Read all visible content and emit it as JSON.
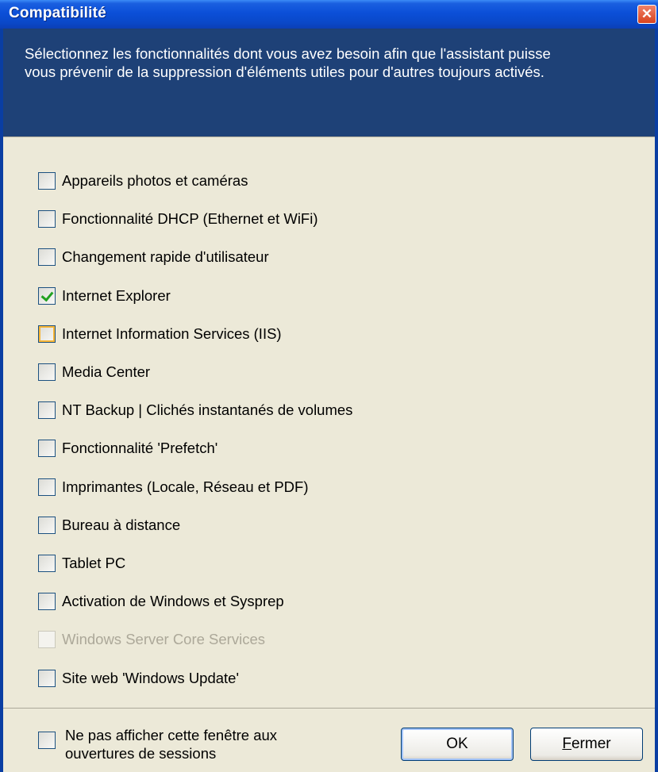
{
  "window": {
    "title": "Compatibilité",
    "close_glyph": "✕"
  },
  "header": {
    "description_line1": "Sélectionnez les fonctionnalités dont vous avez besoin afin que l'assistant puisse",
    "description_line2": "vous prévenir de la suppression d'éléments utiles pour d'autres toujours activés."
  },
  "options": [
    {
      "label": "Appareils photos et caméras",
      "checked": false,
      "state": "normal"
    },
    {
      "label": "Fonctionnalité DHCP (Ethernet et WiFi)",
      "checked": false,
      "state": "normal"
    },
    {
      "label": "Changement rapide d'utilisateur",
      "checked": false,
      "state": "normal"
    },
    {
      "label": "Internet Explorer",
      "checked": true,
      "state": "normal"
    },
    {
      "label": "Internet Information Services (IIS)",
      "checked": false,
      "state": "hover"
    },
    {
      "label": "Media Center",
      "checked": false,
      "state": "normal"
    },
    {
      "label": "NT Backup | Clichés instantanés de volumes",
      "checked": false,
      "state": "normal"
    },
    {
      "label": "Fonctionnalité 'Prefetch'",
      "checked": false,
      "state": "normal"
    },
    {
      "label": "Imprimantes (Locale, Réseau et PDF)",
      "checked": false,
      "state": "normal"
    },
    {
      "label": "Bureau à distance",
      "checked": false,
      "state": "normal"
    },
    {
      "label": "Tablet PC",
      "checked": false,
      "state": "normal"
    },
    {
      "label": "Activation de Windows et Sysprep",
      "checked": false,
      "state": "normal"
    },
    {
      "label": "Windows Server Core Services",
      "checked": false,
      "state": "disabled"
    },
    {
      "label": "Site web 'Windows Update'",
      "checked": false,
      "state": "normal"
    }
  ],
  "footer": {
    "dont_show_line1": "Ne pas afficher cette fenêtre aux",
    "dont_show_line2": "ouvertures de sessions",
    "dont_show_checked": false,
    "ok_label": "OK",
    "close_label_first": "F",
    "close_label_rest": "ermer"
  },
  "colors": {
    "titlebar": "#0b4fd8",
    "header_bg": "#1e4177",
    "dialog_bg": "#ece9d8",
    "check": "#21a121"
  }
}
